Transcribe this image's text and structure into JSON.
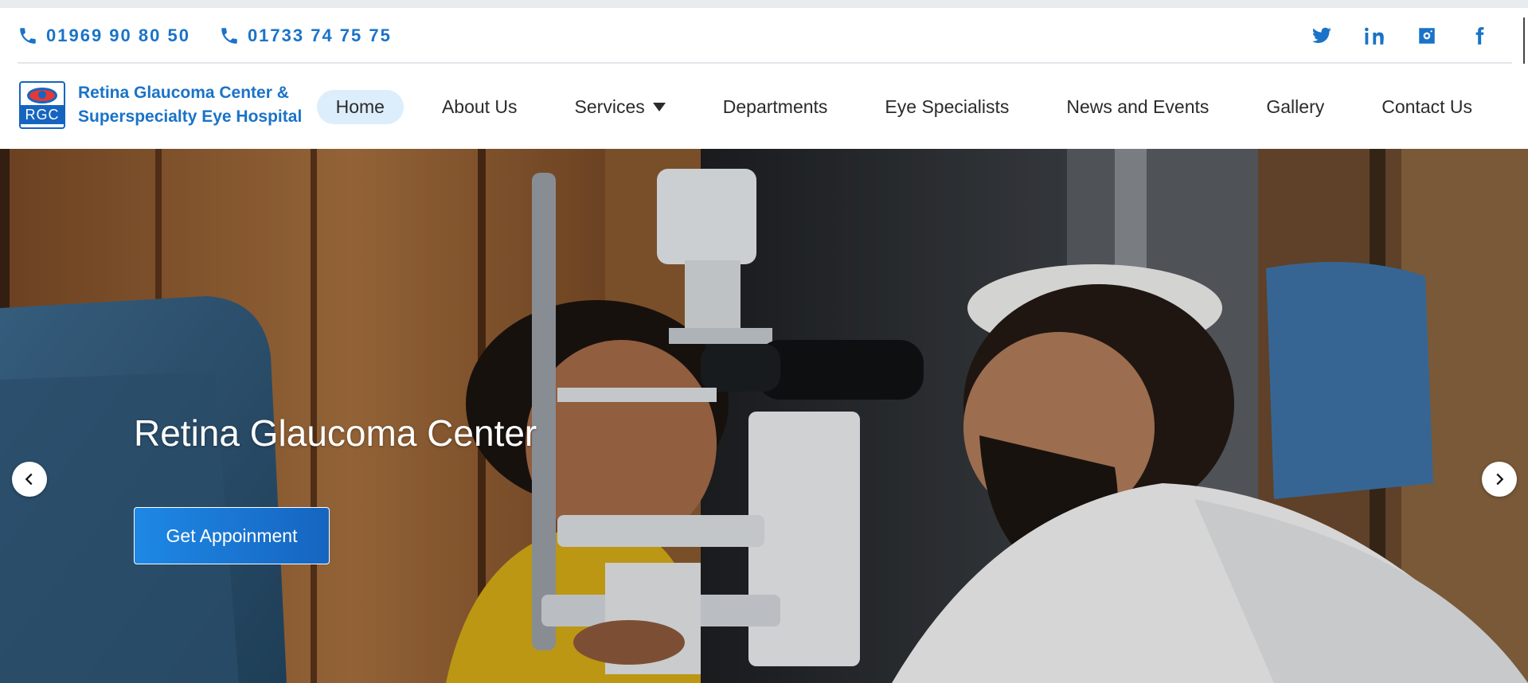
{
  "topbar": {
    "phones": [
      {
        "icon": "phone-icon",
        "number": "01969 90 80 50"
      },
      {
        "icon": "phone-icon",
        "number": "01733 74 75 75"
      }
    ],
    "socials": [
      "twitter-icon",
      "linkedin-icon",
      "instagram-icon",
      "facebook-icon"
    ]
  },
  "navbar": {
    "brand": {
      "logo_text": "RGC",
      "name": "Retina Glaucoma Center & Superspecialty Eye Hospital"
    },
    "menu": [
      {
        "label": "Home",
        "active": true
      },
      {
        "label": "About Us"
      },
      {
        "label": "Services",
        "dropdown": true
      },
      {
        "label": "Departments"
      },
      {
        "label": "Eye Specialists"
      },
      {
        "label": "News and Events"
      },
      {
        "label": "Gallery"
      },
      {
        "label": "Contact Us"
      }
    ]
  },
  "hero": {
    "title": "Retina Glaucoma Center",
    "button": "Get Appoinment",
    "prev_icon": "chevron-left-icon",
    "next_icon": "chevron-right-icon"
  },
  "colors": {
    "brand_blue": "#1a73c8",
    "active_bg": "#dcedfb",
    "button_blue": "#1565c0"
  }
}
